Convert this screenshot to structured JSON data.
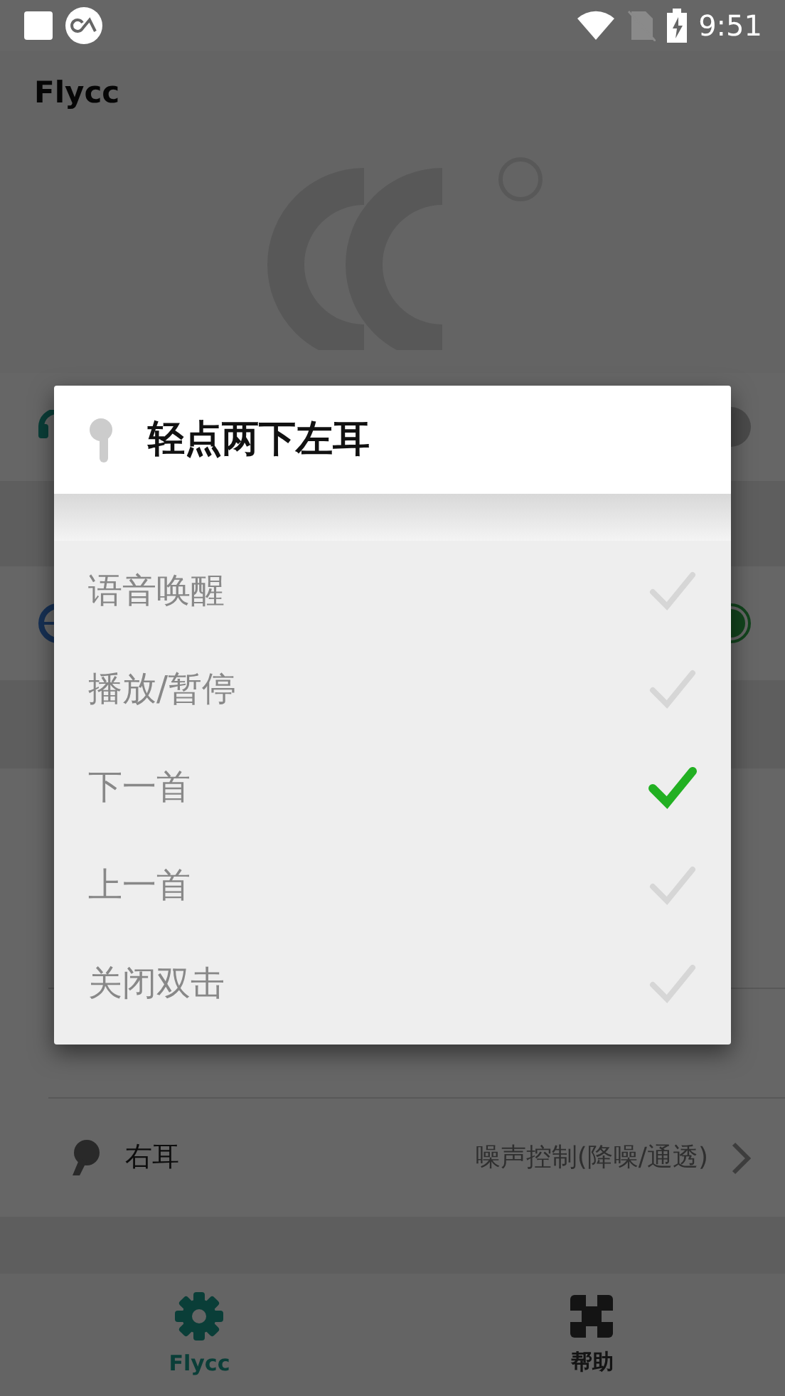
{
  "status_bar": {
    "time": "9:51"
  },
  "app_bar": {
    "title": "Flycc"
  },
  "background_rows": [
    {
      "toggle_on": false
    },
    {
      "toggle_on": true
    }
  ],
  "right_ear_row": {
    "label": "右耳",
    "value": "噪声控制(降噪/通透)"
  },
  "dialog": {
    "title": "轻点两下左耳",
    "options": [
      {
        "label": "语音唤醒",
        "selected": false
      },
      {
        "label": "播放/暂停",
        "selected": false
      },
      {
        "label": "下一首",
        "selected": true
      },
      {
        "label": "上一首",
        "selected": false
      },
      {
        "label": "关闭双击",
        "selected": false
      }
    ]
  },
  "bottom_nav": [
    {
      "label": "Flycc",
      "selected": true
    },
    {
      "label": "帮助",
      "selected": false
    }
  ]
}
